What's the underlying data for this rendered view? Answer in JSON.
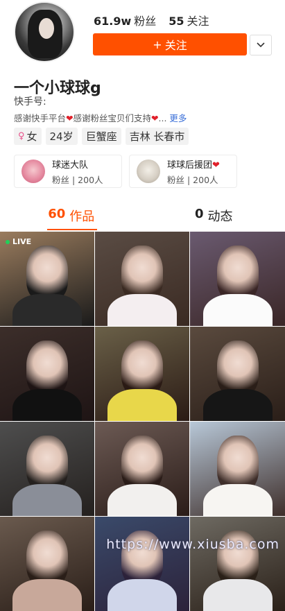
{
  "profile": {
    "fans_count": "61.9w",
    "fans_label": "粉丝",
    "following_count": "55",
    "following_label": "关注",
    "follow_button": "关注",
    "follow_plus": "+",
    "more_icon": "chevron-down-icon",
    "nickname": "一个小球球g",
    "ks_id_label": "快手号:",
    "bio_part1": "感谢快手平台",
    "bio_part2": "感谢粉丝宝贝们支持",
    "bio_heart": "❤",
    "bio_ellipsis": "...",
    "bio_more": "更多",
    "tags": [
      "女",
      "24岁",
      "巨蟹座",
      "吉林 长春市"
    ],
    "gender_icon": "female-icon"
  },
  "fan_groups": [
    {
      "name": "球迷大队",
      "heart": "",
      "sub": "粉丝 | 200人"
    },
    {
      "name": "球球后援团",
      "heart": "❤",
      "sub": "粉丝 | 200人"
    }
  ],
  "tabs": [
    {
      "num": "60",
      "label": "作品"
    },
    {
      "num": "0",
      "label": "动态"
    }
  ],
  "grid": {
    "live_label": "LIVE",
    "colors": [
      [
        "#9a7c5e",
        "#1a1a1a",
        "#2a2a2a"
      ],
      [
        "#5a4c44",
        "#3a2a22",
        "#f4eef0"
      ],
      [
        "#6a5a70",
        "#3a2626",
        "#fbfbfb"
      ],
      [
        "#3c2e2a",
        "#1e1414",
        "#111111"
      ],
      [
        "#6a6048",
        "#2a1a14",
        "#e8d74a"
      ],
      [
        "#5a4a3e",
        "#2a1e18",
        "#161616"
      ],
      [
        "#4e4e4e",
        "#24201e",
        "#8a8e98"
      ],
      [
        "#6c5a54",
        "#2a1c18",
        "#f2f0ee"
      ],
      [
        "#b8c8d8",
        "#3e2e2a",
        "#f7f5f2"
      ],
      [
        "#6a5a4e",
        "#2a1e18",
        "#c8a89a"
      ],
      [
        "#3a4a6a",
        "#2c223a",
        "#d0d6ea"
      ],
      [
        "#6e6a62",
        "#2a2018",
        "#e8e8ea"
      ]
    ]
  },
  "watermark": "https://www.xiusba.com",
  "accent": "#ff5000"
}
